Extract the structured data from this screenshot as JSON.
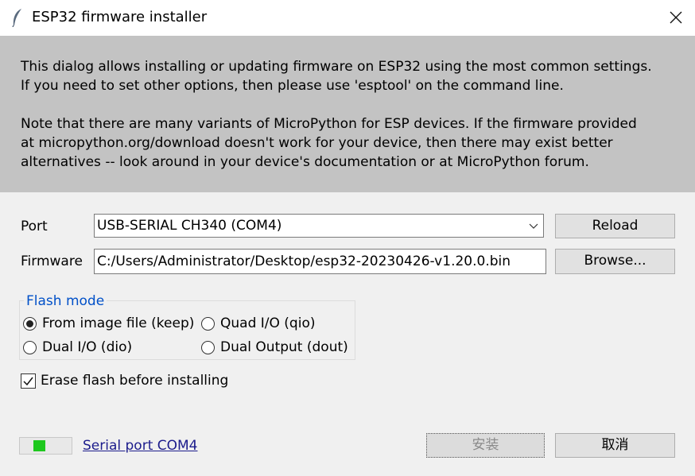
{
  "window": {
    "title": "ESP32 firmware installer",
    "icon": "feather-icon",
    "close_icon": "close-icon"
  },
  "info": {
    "line1": "This dialog allows installing or updating firmware on ESP32 using the most common settings.",
    "line2": "If you need to set other options, then please use 'esptool' on the command line.",
    "line3": "Note that there are many variants of MicroPython for ESP devices. If the firmware provided",
    "line4": "at micropython.org/download doesn't work for your device, then there may exist better",
    "line5": "alternatives -- look around in your device's documentation or at MicroPython forum."
  },
  "port": {
    "label": "Port",
    "value": "USB-SERIAL CH340 (COM4)",
    "reload_label": "Reload"
  },
  "firmware": {
    "label": "Firmware",
    "value": "C:/Users/Administrator/Desktop/esp32-20230426-v1.20.0.bin",
    "browse_label": "Browse..."
  },
  "flash_mode": {
    "title": "Flash mode",
    "options": [
      {
        "label": "From image file (keep)",
        "selected": true
      },
      {
        "label": "Quad I/O (qio)",
        "selected": false
      },
      {
        "label": "Dual I/O (dio)",
        "selected": false
      },
      {
        "label": "Dual Output (dout)",
        "selected": false
      }
    ]
  },
  "erase": {
    "label": "Erase flash before installing",
    "checked": true
  },
  "status": {
    "serial_link": "Serial port COM4",
    "indicator_color": "#1ec81e"
  },
  "actions": {
    "install_label": "安装",
    "cancel_label": "取消"
  },
  "colors": {
    "info_bg": "#c3c3c3",
    "group_title": "#0050c8"
  }
}
